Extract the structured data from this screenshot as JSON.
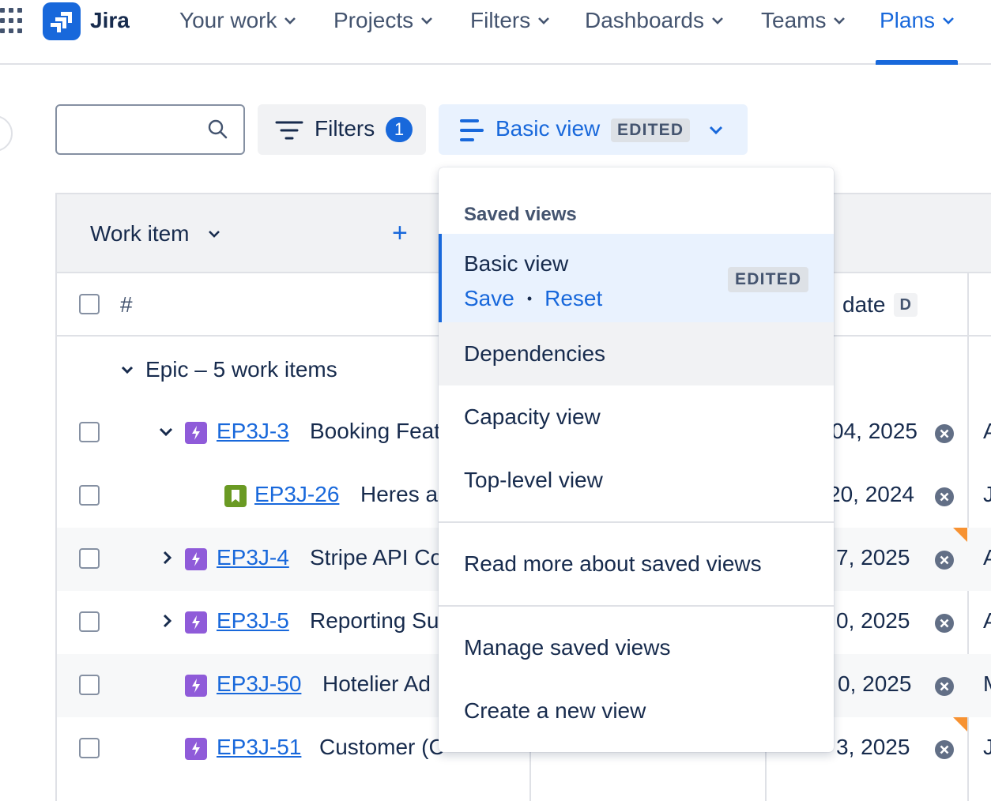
{
  "nav": {
    "logo_text": "Jira",
    "items": [
      {
        "label": "Your work"
      },
      {
        "label": "Projects"
      },
      {
        "label": "Filters"
      },
      {
        "label": "Dashboards"
      },
      {
        "label": "Teams"
      },
      {
        "label": "Plans",
        "active": true
      }
    ],
    "accent_color": "#1868db"
  },
  "toolbar": {
    "search_value": "",
    "filters_label": "Filters",
    "filters_count": "1",
    "view_label": "Basic view",
    "view_status": "EDITED"
  },
  "table": {
    "work_item_header": "Work item",
    "hash_header": "#",
    "date_header": "date",
    "date_key": "D",
    "group_label": "Epic – 5 work items",
    "rows": [
      {
        "key": "EP3J-3",
        "summary": "Booking Feat",
        "date": "04, 2025",
        "trail": "A",
        "type": "epic"
      },
      {
        "key": "EP3J-26",
        "summary": "Heres a",
        "date": "20, 2024",
        "trail": "J",
        "type": "story"
      },
      {
        "key": "EP3J-4",
        "summary": "Stripe API Co",
        "date": "7, 2025",
        "trail": "A",
        "type": "epic"
      },
      {
        "key": "EP3J-5",
        "summary": "Reporting Su",
        "date": "0, 2025",
        "trail": "A",
        "type": "epic"
      },
      {
        "key": "EP3J-50",
        "summary": "Hotelier Ad",
        "date": "0, 2025",
        "trail": "M",
        "type": "epic"
      },
      {
        "key": "EP3J-51",
        "summary": "Customer (C",
        "date": "3, 2025",
        "trail": "J",
        "type": "epic"
      }
    ]
  },
  "dropdown": {
    "section_title": "Saved views",
    "selected": {
      "name": "Basic view",
      "save": "Save",
      "reset": "Reset",
      "status": "EDITED"
    },
    "views": [
      "Dependencies",
      "Capacity view",
      "Top-level view"
    ],
    "read_more": "Read more about saved views",
    "manage": "Manage saved views",
    "create": "Create a new view"
  }
}
